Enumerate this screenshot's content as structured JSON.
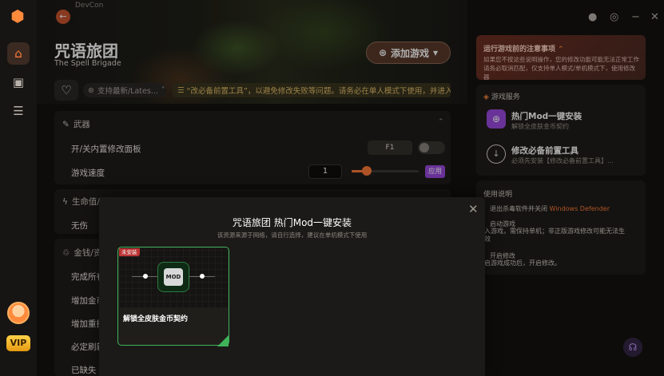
{
  "app": {
    "crumb": "DevCon"
  },
  "rail": {
    "logo": "hexagon-logo-icon",
    "items": [
      {
        "name": "home",
        "glyph": "⌂"
      },
      {
        "name": "games",
        "glyph": "🎮"
      },
      {
        "name": "storage",
        "glyph": "☰"
      }
    ],
    "vip_label": "VIP"
  },
  "header": {
    "title": "咒语旅团",
    "subtitle": "The Spell Brigade",
    "add_game_label": "添加游戏",
    "latest_label": "支持最新/Lates...",
    "notice": "“改必备前置工具”，以避免修改失败等问题。请务必在单人模式下使用，并进入"
  },
  "window_controls": [
    "●",
    "◎",
    "−",
    "✕"
  ],
  "sections": [
    {
      "title": "武器",
      "rows": [
        {
          "label": "开/关内置修改面板",
          "key": "F1"
        },
        {
          "label": "游戏速度",
          "value": "1",
          "apply": "应用"
        }
      ]
    },
    {
      "title": "生命值/护",
      "rows": [
        {
          "label": "无伤"
        }
      ]
    },
    {
      "title": "金钱/资",
      "rows": [
        {
          "label": "完成所有"
        },
        {
          "label": "增加金币"
        },
        {
          "label": "增加重掷"
        },
        {
          "label": "必定刷新"
        },
        {
          "label": "已缺失"
        }
      ]
    }
  ],
  "warning": {
    "title": "运行游戏前的注意事项",
    "body": "如果您不按这些说明操作，您的修改功能可能无法正常工作请务必取消匹配，仅支持单人模式/单机模式下，使用修改器"
  },
  "services": {
    "head": "游戏服务",
    "items": [
      {
        "title": "热门Mod一键安装",
        "sub": "解锁全皮肤金币契约"
      },
      {
        "title": "修改必备前置工具",
        "sub": "必须先安装【修改必备前置工具】..."
      }
    ]
  },
  "help": {
    "head": "使用说明",
    "lines": [
      {
        "text": "退出杀毒软件并关闭",
        "highlight": "Windows Defender"
      },
      {
        "text": "启动游戏"
      },
      {
        "text": "入游戏，需保持单机；非正版游戏修改可能无法生"
      },
      {
        "text": "效"
      },
      {
        "text": "开启修改"
      },
      {
        "text": "启游戏成功后，开启修改。"
      }
    ]
  },
  "modal": {
    "title": "咒语旅团 热门Mod一键安装",
    "subtitle": "该资源来源于网络，请自行选择，建议在单机模式下使用",
    "card": {
      "tag": "未安装",
      "icon_text": "MOD",
      "title": "解锁全皮肤金币契约"
    }
  },
  "colors": {
    "accent": "#ff7b39",
    "purple": "#9b4be0",
    "green": "#3fb25a"
  }
}
